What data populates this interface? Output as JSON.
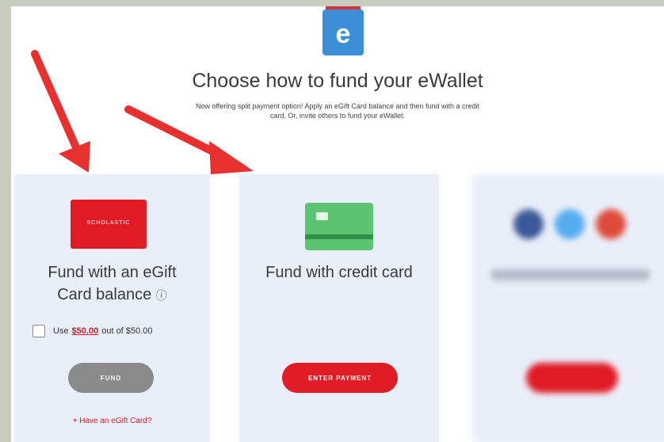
{
  "header": {
    "logo_icon": "ewallet-logo-icon",
    "title": "Choose how to fund your eWallet",
    "subtitle": "Now offering split payment option! Apply an eGift Card balance and then fund with a credit card. Or, invite others to fund your eWallet."
  },
  "cards": [
    {
      "image_text": "SCHOLASTIC",
      "heading_line1": "Fund with an eGift",
      "heading_line2": "Card balance",
      "info_icon": "ⓘ",
      "use_prefix": "Use",
      "use_amount": "$50.00",
      "use_suffix": "out of $50.00",
      "checked": false,
      "button_label": "FUND",
      "link_text": "+ Have an eGift Card?"
    },
    {
      "heading": "Fund with credit card",
      "button_label": "ENTER PAYMENT"
    },
    {
      "blurred": true
    }
  ],
  "colors": {
    "accent_red": "#e01b24",
    "card_bg": "#e9eef9",
    "card_green": "#5cc471",
    "logo_blue": "#3c8fd6"
  }
}
